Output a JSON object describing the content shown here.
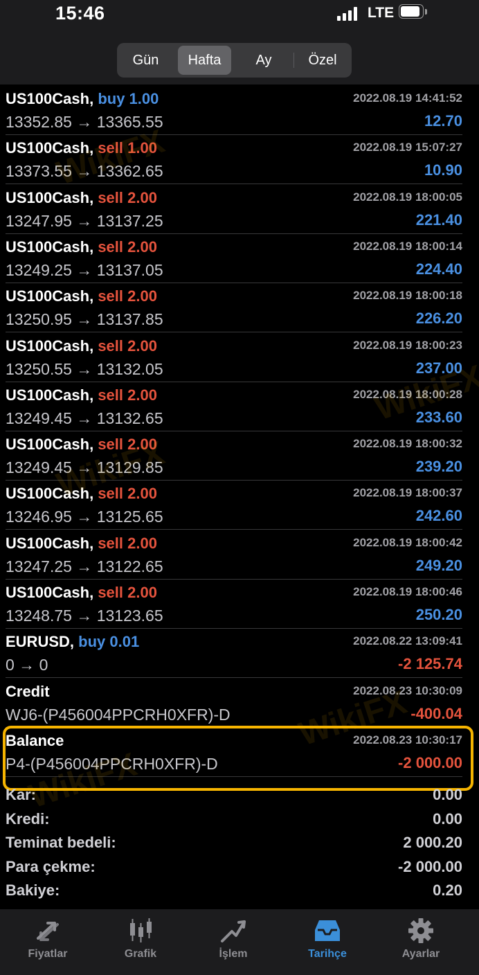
{
  "status": {
    "time": "15:46",
    "network": "LTE"
  },
  "periods": {
    "items": [
      "Gün",
      "Hafta",
      "Ay",
      "Özel"
    ],
    "active": "Hafta"
  },
  "rows": [
    {
      "symbol": "US100Cash,",
      "action": "buy 1.00",
      "action_color": "blue",
      "time": "2022.08.19 14:41:52",
      "prices": "13352.85 → 13365.55",
      "profit": "12.70",
      "profit_color": "blue"
    },
    {
      "symbol": "US100Cash,",
      "action": "sell 1.00",
      "action_color": "red",
      "time": "2022.08.19 15:07:27",
      "prices": "13373.55 → 13362.65",
      "profit": "10.90",
      "profit_color": "blue"
    },
    {
      "symbol": "US100Cash,",
      "action": "sell 2.00",
      "action_color": "red",
      "time": "2022.08.19 18:00:05",
      "prices": "13247.95 → 13137.25",
      "profit": "221.40",
      "profit_color": "blue"
    },
    {
      "symbol": "US100Cash,",
      "action": "sell 2.00",
      "action_color": "red",
      "time": "2022.08.19 18:00:14",
      "prices": "13249.25 → 13137.05",
      "profit": "224.40",
      "profit_color": "blue"
    },
    {
      "symbol": "US100Cash,",
      "action": "sell 2.00",
      "action_color": "red",
      "time": "2022.08.19 18:00:18",
      "prices": "13250.95 → 13137.85",
      "profit": "226.20",
      "profit_color": "blue"
    },
    {
      "symbol": "US100Cash,",
      "action": "sell 2.00",
      "action_color": "red",
      "time": "2022.08.19 18:00:23",
      "prices": "13250.55 → 13132.05",
      "profit": "237.00",
      "profit_color": "blue"
    },
    {
      "symbol": "US100Cash,",
      "action": "sell 2.00",
      "action_color": "red",
      "time": "2022.08.19 18:00:28",
      "prices": "13249.45 → 13132.65",
      "profit": "233.60",
      "profit_color": "blue"
    },
    {
      "symbol": "US100Cash,",
      "action": "sell 2.00",
      "action_color": "red",
      "time": "2022.08.19 18:00:32",
      "prices": "13249.45 → 13129.85",
      "profit": "239.20",
      "profit_color": "blue"
    },
    {
      "symbol": "US100Cash,",
      "action": "sell 2.00",
      "action_color": "red",
      "time": "2022.08.19 18:00:37",
      "prices": "13246.95 → 13125.65",
      "profit": "242.60",
      "profit_color": "blue"
    },
    {
      "symbol": "US100Cash,",
      "action": "sell 2.00",
      "action_color": "red",
      "time": "2022.08.19 18:00:42",
      "prices": "13247.25 → 13122.65",
      "profit": "249.20",
      "profit_color": "blue"
    },
    {
      "symbol": "US100Cash,",
      "action": "sell 2.00",
      "action_color": "red",
      "time": "2022.08.19 18:00:46",
      "prices": "13248.75 → 13123.65",
      "profit": "250.20",
      "profit_color": "blue"
    },
    {
      "symbol": "EURUSD,",
      "action": "buy 0.01",
      "action_color": "blue",
      "time": "2022.08.22 13:09:41",
      "prices": "0 → 0",
      "profit": "-2 125.74",
      "profit_color": "red"
    },
    {
      "symbol": "Credit",
      "action": "",
      "action_color": "blue",
      "time": "2022.08.23 10:30:09",
      "prices": "WJ6-(P456004PPCRH0XFR)-D",
      "profit": "-400.04",
      "profit_color": "red"
    },
    {
      "symbol": "Balance",
      "action": "",
      "action_color": "blue",
      "time": "2022.08.23 10:30:17",
      "prices": "P4-(P456004PPCRH0XFR)-D",
      "profit": "-2 000.00",
      "profit_color": "red"
    }
  ],
  "summary": [
    {
      "label": "Kar:",
      "value": "0.00"
    },
    {
      "label": "Kredi:",
      "value": "0.00"
    },
    {
      "label": "Teminat bedeli:",
      "value": "2 000.20"
    },
    {
      "label": "Para çekme:",
      "value": "-2 000.00"
    },
    {
      "label": "Bakiye:",
      "value": "0.20"
    }
  ],
  "tabs": [
    {
      "label": "Fiyatlar",
      "icon": "price-arrows-icon"
    },
    {
      "label": "Grafik",
      "icon": "candlestick-chart-icon"
    },
    {
      "label": "İşlem",
      "icon": "trade-line-icon"
    },
    {
      "label": "Tarihçe",
      "icon": "history-inbox-icon"
    },
    {
      "label": "Ayarlar",
      "icon": "gear-icon"
    }
  ],
  "active_tab": "Tarihçe",
  "colors": {
    "buy_blue": "#4a90e2",
    "sell_red": "#e5533d",
    "highlight": "#f6b400",
    "active_tab": "#3b8fd9"
  },
  "watermark": "WikiFX"
}
